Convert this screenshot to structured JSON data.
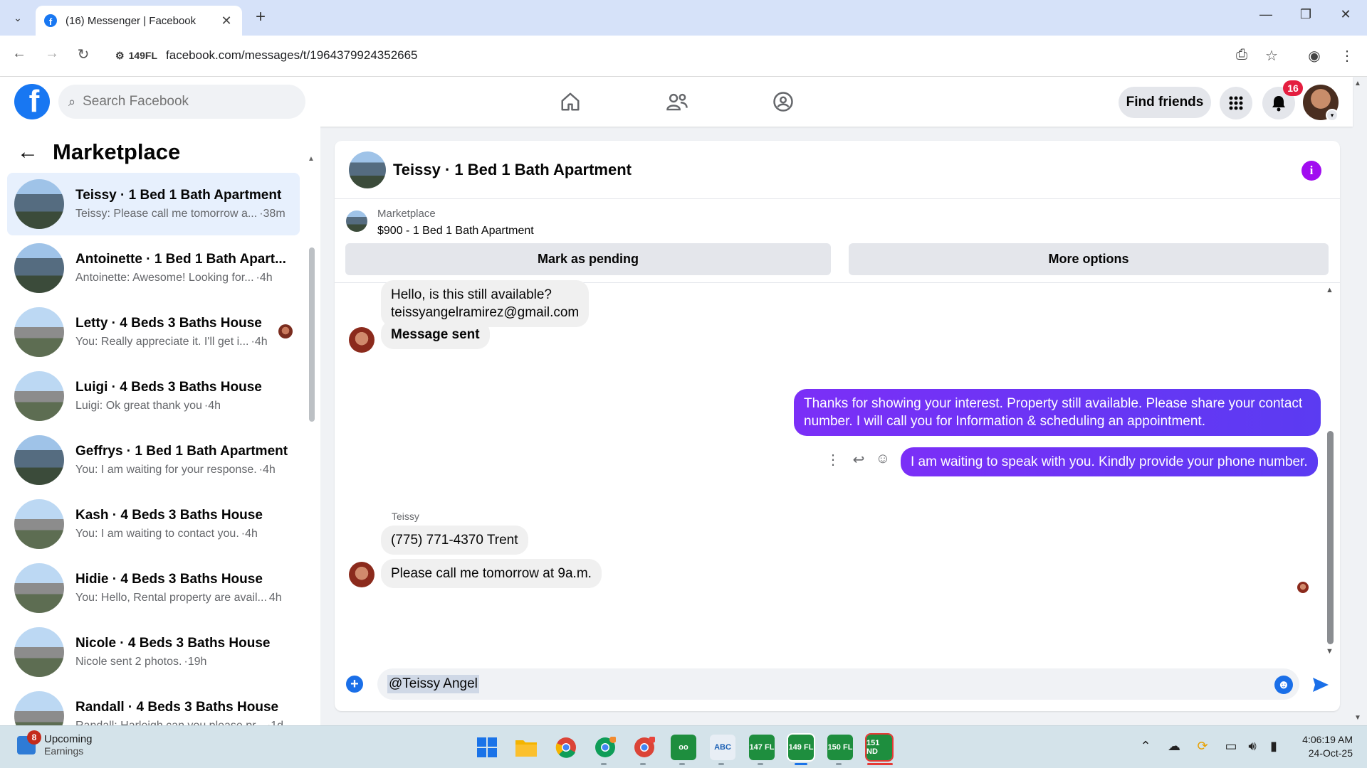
{
  "browser": {
    "tab_title": "(16) Messenger | Facebook",
    "site_chip": "149FL",
    "url": "facebook.com/messages/t/1964379924352665"
  },
  "header": {
    "search_placeholder": "Search Facebook",
    "find_friends": "Find friends",
    "notification_count": "16"
  },
  "sidebar": {
    "title": "Marketplace",
    "conversations": [
      {
        "name": "Teissy · 1 Bed 1 Bath Apartment",
        "preview": "Teissy: Please call me tomorrow a...",
        "time": "·38m",
        "thumb": "apartment",
        "active": true,
        "bold": true
      },
      {
        "name": "Antoinette · 1 Bed 1 Bath Apart...",
        "preview": "Antoinette: Awesome! Looking for...",
        "time": "·4h",
        "thumb": "apartment",
        "active": false,
        "bold": true
      },
      {
        "name": "Letty · 4 Beds 3 Baths House",
        "preview": "You: Really appreciate it. I'll get i...",
        "time": "·4h",
        "thumb": "house",
        "active": false,
        "bold": true
      },
      {
        "name": "Luigi · 4 Beds 3 Baths House",
        "preview": "Luigi: Ok great thank you",
        "time": "·4h",
        "thumb": "house",
        "active": false,
        "bold": true
      },
      {
        "name": "Geffrys · 1 Bed 1 Bath Apartment",
        "preview": "You: I am waiting for your response.",
        "time": "·4h",
        "thumb": "apartment",
        "active": false,
        "bold": true
      },
      {
        "name": "Kash · 4 Beds 3 Baths House",
        "preview": "You: I am waiting to contact you.",
        "time": "·4h",
        "thumb": "house",
        "active": false,
        "bold": true
      },
      {
        "name": "Hidie · 4 Beds 3 Baths House",
        "preview": "You: Hello, Rental property are avail...",
        "time": "4h",
        "thumb": "house",
        "active": false,
        "bold": true
      },
      {
        "name": "Nicole · 4 Beds 3 Baths House",
        "preview": "Nicole sent 2 photos.",
        "time": "·19h",
        "thumb": "house",
        "active": false,
        "bold": true
      },
      {
        "name": "Randall · 4 Beds 3 Baths House",
        "preview": "Randall: Harleigh can you please pr...",
        "time": "·1d",
        "thumb": "house",
        "active": false,
        "bold": true
      }
    ]
  },
  "chat": {
    "title": "Teissy · 1 Bed 1 Bath Apartment",
    "listing_source": "Marketplace",
    "listing_price": "$900 - 1 Bed 1 Bath Apartment",
    "mark_pending": "Mark as pending",
    "more_options": "More options",
    "messages": {
      "m1_line1": "Hello, is this still available?",
      "m1_line2": "teissyangelramirez@gmail.com",
      "m2": "Message sent",
      "m3": "Thanks for showing your interest. Property still available. Please share your contact number. I will call you for Information & scheduling an appointment.",
      "m4": "I am waiting to speak with you. Kindly provide your phone number.",
      "sender": "Teissy",
      "m5": "(775) 771-4370 Trent",
      "m6": "Please call me  tomorrow at 9a.m."
    },
    "composer_text": "@Teissy Angel"
  },
  "taskbar": {
    "weather_badge": "8",
    "weather_title": "Upcoming",
    "weather_sub": "Earnings",
    "apps": [
      "147 FL",
      "149 FL",
      "150 FL",
      "151 ND"
    ],
    "time": "4:06:19 AM",
    "date": "24-Oct-25"
  },
  "colors": {
    "fb_blue": "#1877f2",
    "outgoing_bubble": "#6e33f5",
    "active_conversation": "#e7f0fd",
    "notification_badge": "#e41e3f"
  }
}
